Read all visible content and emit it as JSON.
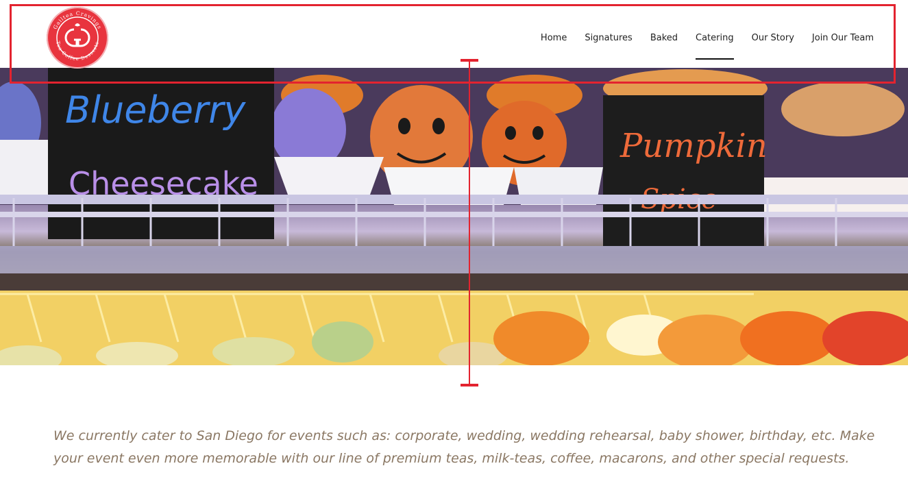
{
  "header": {
    "logo": {
      "ring_text_top": "Gailtea Cravings",
      "ring_text_bottom": "Tea Coffee Desserts",
      "brand_color": "#e8343e"
    },
    "nav": [
      {
        "label": "Home",
        "active": false
      },
      {
        "label": "Signatures",
        "active": false
      },
      {
        "label": "Baked",
        "active": false
      },
      {
        "label": "Catering",
        "active": true
      },
      {
        "label": "Our Story",
        "active": false
      },
      {
        "label": "Join Our Team",
        "active": false
      }
    ]
  },
  "hero": {
    "sign_left_line1": "Blueberry",
    "sign_left_line2": "Cheesecake",
    "sign_right_line1": "Pumpkin",
    "sign_right_line2": "Spice"
  },
  "intro": {
    "text": "We currently cater to San Diego for events such as: corporate, wedding, wedding rehearsal, baby shower, birthday, etc. Make your event even more memorable with our line of premium teas, milk-teas, coffee, macarons, and other special requests."
  },
  "annotation_color": "#e3232f"
}
